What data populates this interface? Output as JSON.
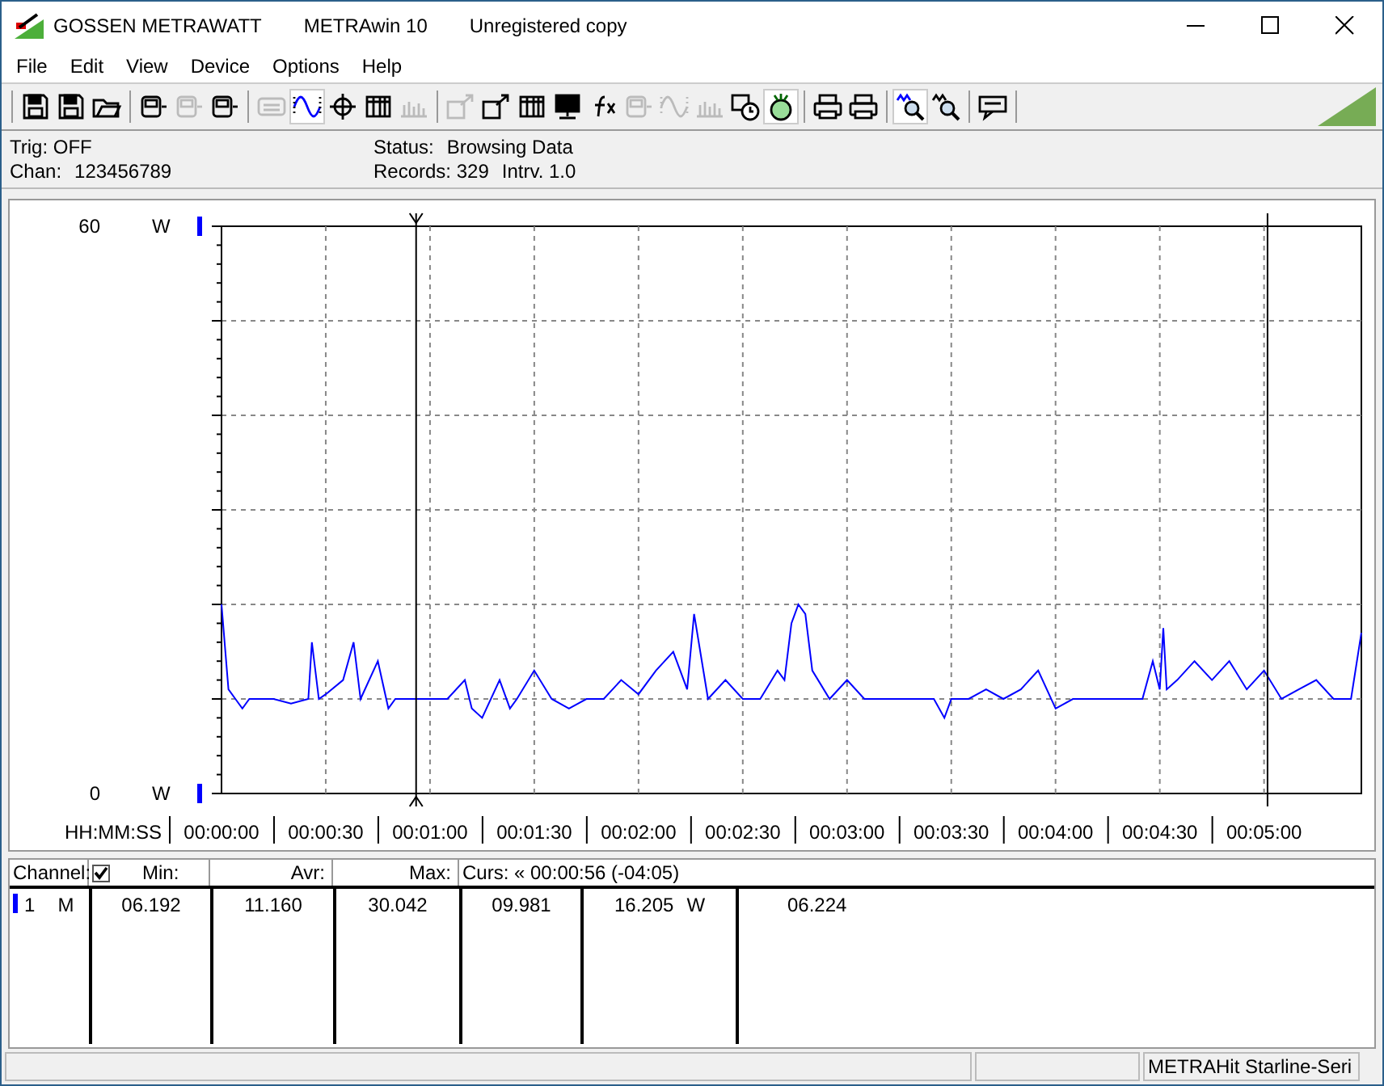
{
  "window": {
    "title_parts": [
      "GOSSEN METRAWATT",
      "METRAwin 10",
      "Unregistered copy"
    ]
  },
  "menu": [
    "File",
    "Edit",
    "View",
    "Device",
    "Options",
    "Help"
  ],
  "toolbar": [
    [
      {
        "kind": "floppy",
        "selected": false,
        "disabled": false
      },
      {
        "kind": "floppy",
        "selected": false,
        "disabled": false
      },
      {
        "kind": "folder",
        "selected": false,
        "disabled": false
      }
    ],
    [
      {
        "kind": "meter",
        "selected": false,
        "disabled": false
      },
      {
        "kind": "meter",
        "selected": false,
        "disabled": true
      },
      {
        "kind": "meter",
        "selected": false,
        "disabled": false
      }
    ],
    [
      {
        "kind": "keys",
        "selected": false,
        "disabled": true
      },
      {
        "kind": "wave",
        "selected": true,
        "disabled": false
      },
      {
        "kind": "crosshair",
        "selected": false,
        "disabled": false
      },
      {
        "kind": "table",
        "selected": false,
        "disabled": false
      },
      {
        "kind": "bars",
        "selected": false,
        "disabled": true
      }
    ],
    [
      {
        "kind": "export",
        "selected": false,
        "disabled": true
      },
      {
        "kind": "export",
        "selected": false,
        "disabled": false
      },
      {
        "kind": "table",
        "selected": false,
        "disabled": false
      },
      {
        "kind": "monitor",
        "selected": false,
        "disabled": false
      },
      {
        "kind": "function",
        "selected": false,
        "disabled": false
      },
      {
        "kind": "meter",
        "selected": false,
        "disabled": true
      },
      {
        "kind": "wave",
        "selected": false,
        "disabled": true
      },
      {
        "kind": "bars",
        "selected": false,
        "disabled": true
      },
      {
        "kind": "clock",
        "selected": false,
        "disabled": false
      },
      {
        "kind": "bug",
        "selected": true,
        "disabled": false
      }
    ],
    [
      {
        "kind": "printer",
        "selected": false,
        "disabled": false
      },
      {
        "kind": "printer",
        "selected": false,
        "disabled": false
      }
    ],
    [
      {
        "kind": "zoom",
        "selected": true,
        "disabled": false
      },
      {
        "kind": "zoom",
        "selected": false,
        "disabled": false
      }
    ],
    [
      {
        "kind": "speech",
        "selected": false,
        "disabled": false
      }
    ]
  ],
  "info": {
    "trig": "Trig: OFF",
    "chan_label": "Chan:",
    "chan": "123456789",
    "status_label": "Status:",
    "status": "Browsing Data",
    "records": "Records: 329",
    "interval": "Intrv. 1.0"
  },
  "plot": {
    "unit_top": "W",
    "unit_bottom": "W",
    "x_axis_label": "HH:MM:SS",
    "chart_data": {
      "type": "line",
      "ylim": [
        0,
        60
      ],
      "xlim": [
        0,
        328
      ],
      "yticks": [
        0,
        60
      ],
      "xticks": [
        {
          "value": 0,
          "label": "00:00:00"
        },
        {
          "value": 30,
          "label": "00:00:30"
        },
        {
          "value": 60,
          "label": "00:01:00"
        },
        {
          "value": 90,
          "label": "00:01:30"
        },
        {
          "value": 120,
          "label": "00:02:00"
        },
        {
          "value": 150,
          "label": "00:02:30"
        },
        {
          "value": 180,
          "label": "00:03:00"
        },
        {
          "value": 210,
          "label": "00:03:30"
        },
        {
          "value": 240,
          "label": "00:04:00"
        },
        {
          "value": 270,
          "label": "00:04:30"
        },
        {
          "value": 300,
          "label": "00:05:00"
        }
      ],
      "x": [
        0,
        2,
        4,
        6,
        8,
        10,
        15,
        20,
        25,
        26,
        28,
        30,
        35,
        38,
        40,
        45,
        48,
        50,
        55,
        60,
        65,
        70,
        72,
        75,
        80,
        83,
        85,
        90,
        95,
        100,
        105,
        110,
        115,
        120,
        125,
        130,
        134,
        136,
        140,
        145,
        150,
        155,
        160,
        162,
        164,
        166,
        168,
        170,
        175,
        180,
        185,
        190,
        195,
        200,
        205,
        208,
        210,
        215,
        220,
        225,
        230,
        235,
        240,
        245,
        250,
        255,
        260,
        265,
        268,
        270,
        271,
        272,
        275,
        280,
        285,
        290,
        295,
        300,
        305,
        310,
        315,
        320,
        325,
        328
      ],
      "series": [
        {
          "color": "#0000ff",
          "values": [
            20,
            11,
            10,
            9,
            10,
            10,
            10,
            9.5,
            10,
            16,
            10,
            10.5,
            12,
            16,
            10,
            14,
            9,
            10,
            10,
            10,
            10,
            12,
            9,
            8,
            12,
            9,
            10,
            13,
            10,
            9,
            10,
            10,
            12,
            10.5,
            13,
            15,
            11,
            19,
            10,
            12,
            10,
            10,
            13,
            12,
            18,
            20,
            19,
            13,
            10,
            12,
            10,
            10,
            10,
            10,
            10,
            8,
            10,
            10,
            11,
            10,
            11,
            13,
            9,
            10,
            10,
            10,
            10,
            10,
            14,
            11,
            17.5,
            11,
            12,
            14,
            12,
            14,
            11,
            13,
            10,
            11,
            12,
            10,
            10,
            17
          ]
        }
      ],
      "grid": true,
      "ref_lines": [
        {
          "axis": "x",
          "value": 56
        },
        {
          "axis": "x",
          "value": 301
        }
      ]
    }
  },
  "table": {
    "header": {
      "channel": "Channel:",
      "shown": true,
      "min": "Min:",
      "avr": "Avr:",
      "max": "Max:",
      "cursor": "Curs: « 00:00:56 (-04:05)"
    },
    "rows": [
      {
        "number": "1",
        "mode": "M",
        "color": "#0000ff",
        "min": "06.192",
        "avr": "11.160",
        "max": "30.042",
        "cursor_value": "09.981",
        "delta": "16.205",
        "unit": "W",
        "cursor2_value": "06.224"
      }
    ]
  },
  "status_bar": {
    "device": "METRAHit Starline-Seri"
  }
}
